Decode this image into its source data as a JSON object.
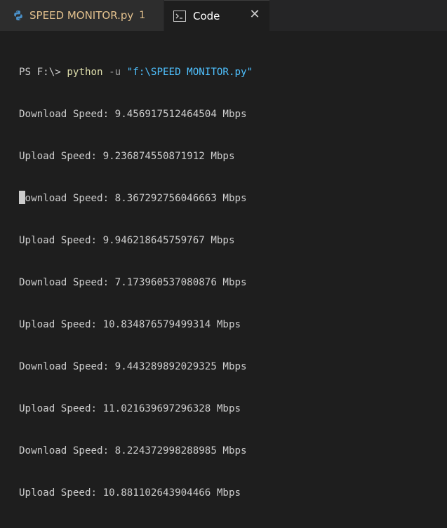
{
  "tabs": {
    "file_tab": {
      "label": "SPEED MONITOR.py",
      "badge": "1",
      "icon": "python-icon"
    },
    "code_tab": {
      "label": "Code",
      "icon": "terminal-icon",
      "close": "✕"
    }
  },
  "terminal": {
    "prompt": "PS F:\\> ",
    "command": "python",
    "flag": " -u ",
    "arg": "\"f:\\SPEED MONITOR.py\"",
    "output": [
      "Download Speed: 9.456917512464504 Mbps",
      "Upload Speed: 9.236874550871912 Mbps",
      "Download Speed: 8.367292756046663 Mbps",
      "Upload Speed: 9.946218645759767 Mbps",
      "Download Speed: 7.173960537080876 Mbps",
      "Upload Speed: 10.834876579499314 Mbps",
      "Download Speed: 9.443289892029325 Mbps",
      "Upload Speed: 11.021639697296328 Mbps",
      "Download Speed: 8.224372998288985 Mbps",
      "Upload Speed: 10.881102643904466 Mbps"
    ]
  },
  "colors": {
    "background": "#1e1e1e",
    "tabbar": "#252526",
    "inactive_tab": "#2d2d2d",
    "modified_label": "#e2c08d",
    "python_cmd": "#dcdcaa",
    "string": "#4fc1ff"
  }
}
